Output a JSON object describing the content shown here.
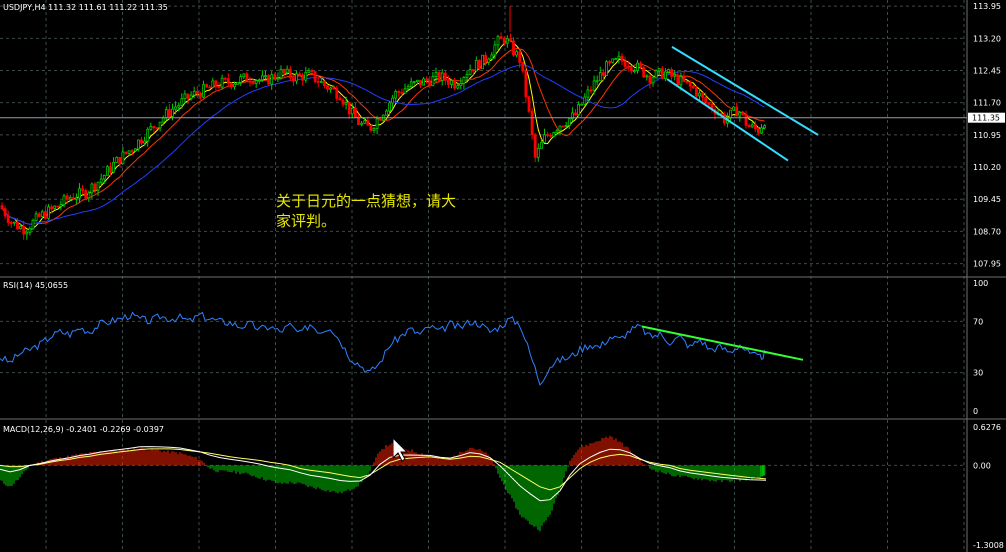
{
  "chart_data": [
    {
      "type": "candlestick",
      "header": "USDJPY,H4  111.32 111.61 111.22 111.35",
      "y_ticks": [
        "113.95",
        "113.20",
        "112.45",
        "111.70",
        "110.95",
        "110.20",
        "109.45",
        "108.70",
        "107.95"
      ],
      "current_price_label": "111.35",
      "annotation": [
        "关于日元的一点猜想，请大",
        "家评判。"
      ],
      "ylim": [
        107.8,
        114.0
      ],
      "colors": {
        "bull": "#00cc00",
        "bear": "#ff0000",
        "ma_fast": "#ffff00",
        "ma_mid": "#ff3300",
        "ma_slow": "#1f3fff",
        "channel": "#33ddff"
      },
      "waypoints": [
        [
          0,
          109.3
        ],
        [
          12,
          108.9
        ],
        [
          25,
          108.75
        ],
        [
          40,
          109.05
        ],
        [
          55,
          109.25
        ],
        [
          70,
          109.5
        ],
        [
          85,
          109.6
        ],
        [
          100,
          109.9
        ],
        [
          115,
          110.3
        ],
        [
          130,
          110.6
        ],
        [
          145,
          110.95
        ],
        [
          160,
          111.3
        ],
        [
          175,
          111.6
        ],
        [
          190,
          111.85
        ],
        [
          205,
          112.0
        ],
        [
          220,
          112.15
        ],
        [
          235,
          112.2
        ],
        [
          250,
          112.3
        ],
        [
          265,
          112.2
        ],
        [
          280,
          112.4
        ],
        [
          295,
          112.3
        ],
        [
          310,
          112.35
        ],
        [
          325,
          112.1
        ],
        [
          340,
          111.9
        ],
        [
          350,
          111.5
        ],
        [
          360,
          111.2
        ],
        [
          370,
          111.1
        ],
        [
          380,
          111.4
        ],
        [
          395,
          111.9
        ],
        [
          410,
          112.1
        ],
        [
          425,
          112.2
        ],
        [
          440,
          112.3
        ],
        [
          455,
          112.15
        ],
        [
          470,
          112.5
        ],
        [
          485,
          112.7
        ],
        [
          497,
          113.1
        ],
        [
          505,
          113.2
        ],
        [
          512,
          112.95
        ],
        [
          520,
          112.7
        ],
        [
          528,
          111.6
        ],
        [
          535,
          110.4
        ],
        [
          545,
          110.9
        ],
        [
          560,
          111.2
        ],
        [
          575,
          111.4
        ],
        [
          590,
          112.0
        ],
        [
          605,
          112.5
        ],
        [
          620,
          112.7
        ],
        [
          635,
          112.55
        ],
        [
          650,
          112.3
        ],
        [
          665,
          112.4
        ],
        [
          680,
          112.2
        ],
        [
          695,
          112.0
        ],
        [
          705,
          111.7
        ],
        [
          715,
          111.55
        ],
        [
          725,
          111.3
        ],
        [
          738,
          111.55
        ],
        [
          748,
          111.15
        ],
        [
          758,
          111.05
        ],
        [
          766,
          111.35
        ]
      ]
    },
    {
      "type": "line",
      "header": "RSI(14) 45.0655",
      "y_ticks": [
        "100",
        "70",
        "30",
        "0"
      ],
      "ylim": [
        0,
        100
      ],
      "colors": {
        "line": "#2f80ff",
        "trend": "#33ff33"
      },
      "x": [
        0,
        10,
        20,
        30,
        40,
        50,
        60,
        70,
        80,
        90,
        100,
        110,
        120,
        130,
        140,
        150,
        160,
        170,
        180,
        190,
        200,
        210,
        220,
        230,
        240,
        250,
        260,
        270,
        280,
        290,
        300,
        310,
        320,
        330,
        340,
        350,
        360,
        370,
        380,
        390,
        400,
        410,
        420,
        430,
        440,
        450,
        460,
        470,
        480,
        490,
        500,
        510,
        520,
        530,
        540,
        550,
        560,
        570,
        580,
        590,
        600,
        610,
        620,
        630,
        640,
        650,
        660,
        670,
        680,
        690,
        700,
        710,
        720,
        730,
        740,
        750,
        760,
        766
      ],
      "values": [
        42,
        38,
        45,
        48,
        52,
        58,
        62,
        60,
        65,
        62,
        68,
        70,
        72,
        75,
        72,
        70,
        74,
        72,
        73,
        70,
        75,
        72,
        70,
        69,
        66,
        68,
        64,
        66,
        62,
        67,
        60,
        68,
        62,
        66,
        55,
        42,
        36,
        30,
        38,
        52,
        58,
        64,
        60,
        66,
        62,
        68,
        65,
        70,
        68,
        62,
        66,
        72,
        68,
        45,
        22,
        35,
        40,
        42,
        48,
        52,
        50,
        58,
        56,
        63,
        66,
        58,
        60,
        54,
        58,
        50,
        56,
        48,
        50,
        46,
        52,
        44,
        42,
        45
      ]
    },
    {
      "type": "bar",
      "header": "MACD(12,26,9) -0.2401 -0.2269 -0.0397",
      "y_ticks": [
        "0.6276",
        "0.00",
        "-1.3008"
      ],
      "ylim": [
        -1.3008,
        0.6276
      ],
      "colors": {
        "hist_up": "#ff2200",
        "hist_down": "#00cc00",
        "signal": "#ffff66",
        "macd_line": "#ffffff"
      },
      "x": [
        0,
        10,
        20,
        30,
        40,
        50,
        60,
        70,
        80,
        90,
        100,
        110,
        120,
        130,
        140,
        150,
        160,
        170,
        180,
        190,
        200,
        210,
        220,
        230,
        240,
        250,
        260,
        270,
        280,
        290,
        300,
        310,
        320,
        330,
        340,
        350,
        360,
        370,
        380,
        390,
        400,
        410,
        420,
        430,
        440,
        450,
        460,
        470,
        480,
        490,
        500,
        510,
        520,
        530,
        540,
        550,
        560,
        570,
        580,
        590,
        600,
        610,
        620,
        630,
        640,
        650,
        660,
        670,
        680,
        690,
        700,
        710,
        720,
        730,
        740,
        750,
        760,
        766
      ],
      "values": [
        -0.25,
        -0.35,
        -0.2,
        0.0,
        0.05,
        0.1,
        0.12,
        0.15,
        0.18,
        0.2,
        0.22,
        0.24,
        0.25,
        0.26,
        0.28,
        0.26,
        0.24,
        0.22,
        0.2,
        0.15,
        0.1,
        -0.05,
        -0.1,
        -0.1,
        -0.12,
        -0.15,
        -0.2,
        -0.25,
        -0.3,
        -0.28,
        -0.3,
        -0.35,
        -0.38,
        -0.42,
        -0.45,
        -0.4,
        -0.3,
        -0.1,
        0.25,
        0.35,
        0.3,
        0.25,
        0.2,
        0.15,
        0.1,
        0.12,
        0.2,
        0.3,
        0.25,
        0.15,
        -0.2,
        -0.5,
        -0.8,
        -0.95,
        -1.05,
        -0.8,
        -0.4,
        0.1,
        0.3,
        0.35,
        0.42,
        0.48,
        0.38,
        0.25,
        0.08,
        -0.05,
        -0.1,
        -0.15,
        -0.18,
        -0.2,
        -0.22,
        -0.24,
        -0.26,
        -0.25,
        -0.24,
        -0.22,
        -0.2,
        -0.18
      ],
      "signal_values": [
        0.0,
        -0.02,
        -0.02,
        0.0,
        0.02,
        0.05,
        0.08,
        0.1,
        0.13,
        0.15,
        0.18,
        0.2,
        0.22,
        0.24,
        0.26,
        0.27,
        0.27,
        0.27,
        0.26,
        0.24,
        0.22,
        0.2,
        0.17,
        0.14,
        0.12,
        0.1,
        0.08,
        0.05,
        0.03,
        0.0,
        -0.05,
        -0.08,
        -0.1,
        -0.12,
        -0.15,
        -0.18,
        -0.2,
        -0.15,
        -0.05,
        0.05,
        0.1,
        0.12,
        0.13,
        0.14,
        0.12,
        0.1,
        0.12,
        0.15,
        0.14,
        0.1,
        0.05,
        -0.05,
        -0.15,
        -0.25,
        -0.35,
        -0.4,
        -0.35,
        -0.2,
        -0.05,
        0.05,
        0.12,
        0.16,
        0.18,
        0.16,
        0.1,
        0.05,
        0.02,
        0.0,
        -0.05,
        -0.08,
        -0.1,
        -0.12,
        -0.14,
        -0.16,
        -0.18,
        -0.2,
        -0.21,
        -0.22
      ]
    }
  ]
}
